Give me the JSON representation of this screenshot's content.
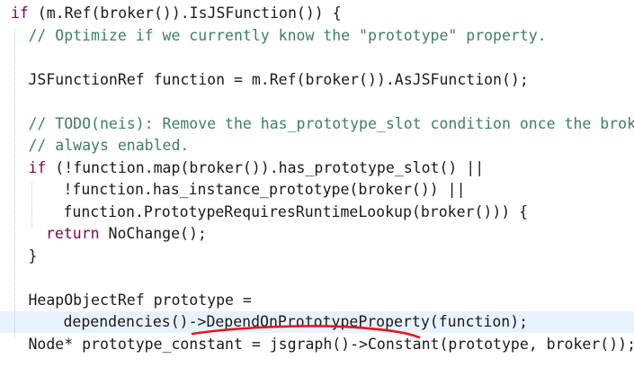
{
  "code": {
    "lines": [
      {
        "indent": 0,
        "segments": [
          {
            "text": "if",
            "kind": "kw"
          },
          {
            "text": " (m.Ref(broker()).IsJSFunction()) {",
            "kind": "pl"
          }
        ]
      },
      {
        "indent": 1,
        "segments": [
          {
            "text": "// Optimize if we currently know the \"prototype\" property.",
            "kind": "cm"
          }
        ]
      },
      {
        "indent": 0,
        "segments": []
      },
      {
        "indent": 1,
        "segments": [
          {
            "text": "JSFunctionRef function = m.Ref(broker()).AsJSFunction();",
            "kind": "pl"
          }
        ]
      },
      {
        "indent": 0,
        "segments": []
      },
      {
        "indent": 1,
        "segments": [
          {
            "text": "// TODO(neis): Remove the has_prototype_slot condition once the broke",
            "kind": "cm"
          }
        ]
      },
      {
        "indent": 1,
        "segments": [
          {
            "text": "// always enabled.",
            "kind": "cm"
          }
        ]
      },
      {
        "indent": 1,
        "segments": [
          {
            "text": "if",
            "kind": "kw"
          },
          {
            "text": " (!function.map(broker()).has_prototype_slot() ||",
            "kind": "pl"
          }
        ]
      },
      {
        "indent": 3,
        "segments": [
          {
            "text": "!function.has_instance_prototype(broker()) ||",
            "kind": "pl"
          }
        ]
      },
      {
        "indent": 3,
        "segments": [
          {
            "text": "function.PrototypeRequiresRuntimeLookup(broker())) {",
            "kind": "pl"
          }
        ]
      },
      {
        "indent": 2,
        "segments": [
          {
            "text": "return",
            "kind": "kw"
          },
          {
            "text": " NoChange();",
            "kind": "pl"
          }
        ]
      },
      {
        "indent": 1,
        "segments": [
          {
            "text": "}",
            "kind": "pl"
          }
        ]
      },
      {
        "indent": 0,
        "segments": []
      },
      {
        "indent": 1,
        "segments": [
          {
            "text": "HeapObjectRef prototype =",
            "kind": "pl"
          }
        ]
      },
      {
        "indent": 3,
        "segments": [
          {
            "text": "dependencies()->DependOnPrototypeProperty(function);",
            "kind": "pl"
          }
        ],
        "highlighted": true
      },
      {
        "indent": 1,
        "segments": [
          {
            "text": "Node* prototype_constant = jsgraph()->Constant(prototype, broker());",
            "kind": "pl"
          }
        ]
      }
    ]
  },
  "annotation": {
    "kind": "red-underline",
    "color": "#e8141b"
  },
  "colors": {
    "keyword": "#7f0055",
    "comment": "#3f7f5f",
    "plain": "#1a1a1a",
    "current_line": "#e8f2fe"
  }
}
